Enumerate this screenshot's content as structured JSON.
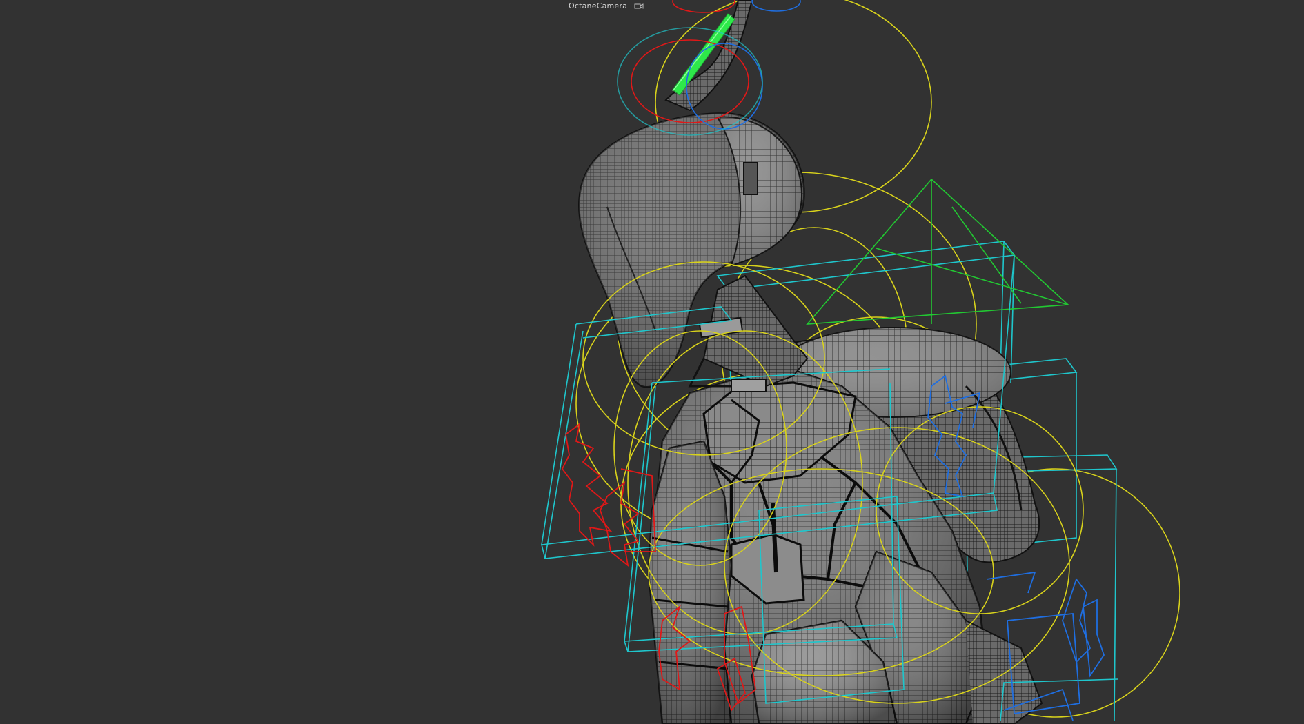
{
  "viewport": {
    "camera_name": "OctaneCamera",
    "camera_icon": "camera-link-icon",
    "background": "#323232"
  },
  "colors": {
    "mesh_fill": "#6b6b6b",
    "mesh_dark": "#3a3a3a",
    "wire": "#1c1c1c",
    "yellow_controller": "#d8d21c",
    "cyan_controller": "#1fc6cc",
    "green_controller": "#22c832",
    "red_controller": "#e01818",
    "blue_controller": "#1f6ee0",
    "selected_bone": "#2ee84a"
  }
}
